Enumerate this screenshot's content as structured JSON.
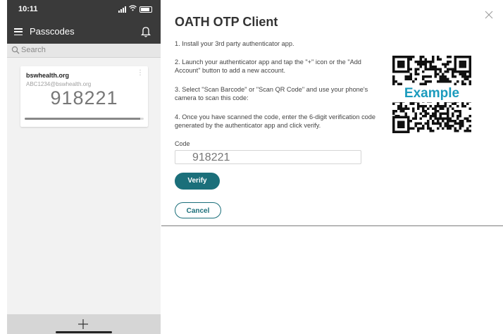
{
  "phone": {
    "time": "10:11",
    "nav_title": "Passcodes",
    "search_placeholder": "Search",
    "card": {
      "issuer": "bswhealth.org",
      "account": "ABC1234@bswhealth.org",
      "code": "918221",
      "menu_glyph": "⋮",
      "progress": 0.97
    }
  },
  "panel": {
    "title": "OATH OTP Client",
    "steps": [
      "1. Install your 3rd party authenticator app.",
      "2. Launch your authenticator app and tap the \"+\" icon or the \"Add Account\" button to add a new account.",
      "3. Select \"Scan Barcode\" or \"Scan QR Code\" and use your phone's camera to scan this code:",
      "4. Once you have scanned the code, enter the 6-digit verification code generated by the authenticator app and click verify."
    ],
    "qr_caption": "Example",
    "code_label": "Code",
    "code_value": "918221",
    "verify_label": "Verify",
    "cancel_label": "Cancel"
  },
  "colors": {
    "accent": "#1b6f7a",
    "example_text": "#1b9bbd",
    "phone_header": "#3a3a3a"
  }
}
